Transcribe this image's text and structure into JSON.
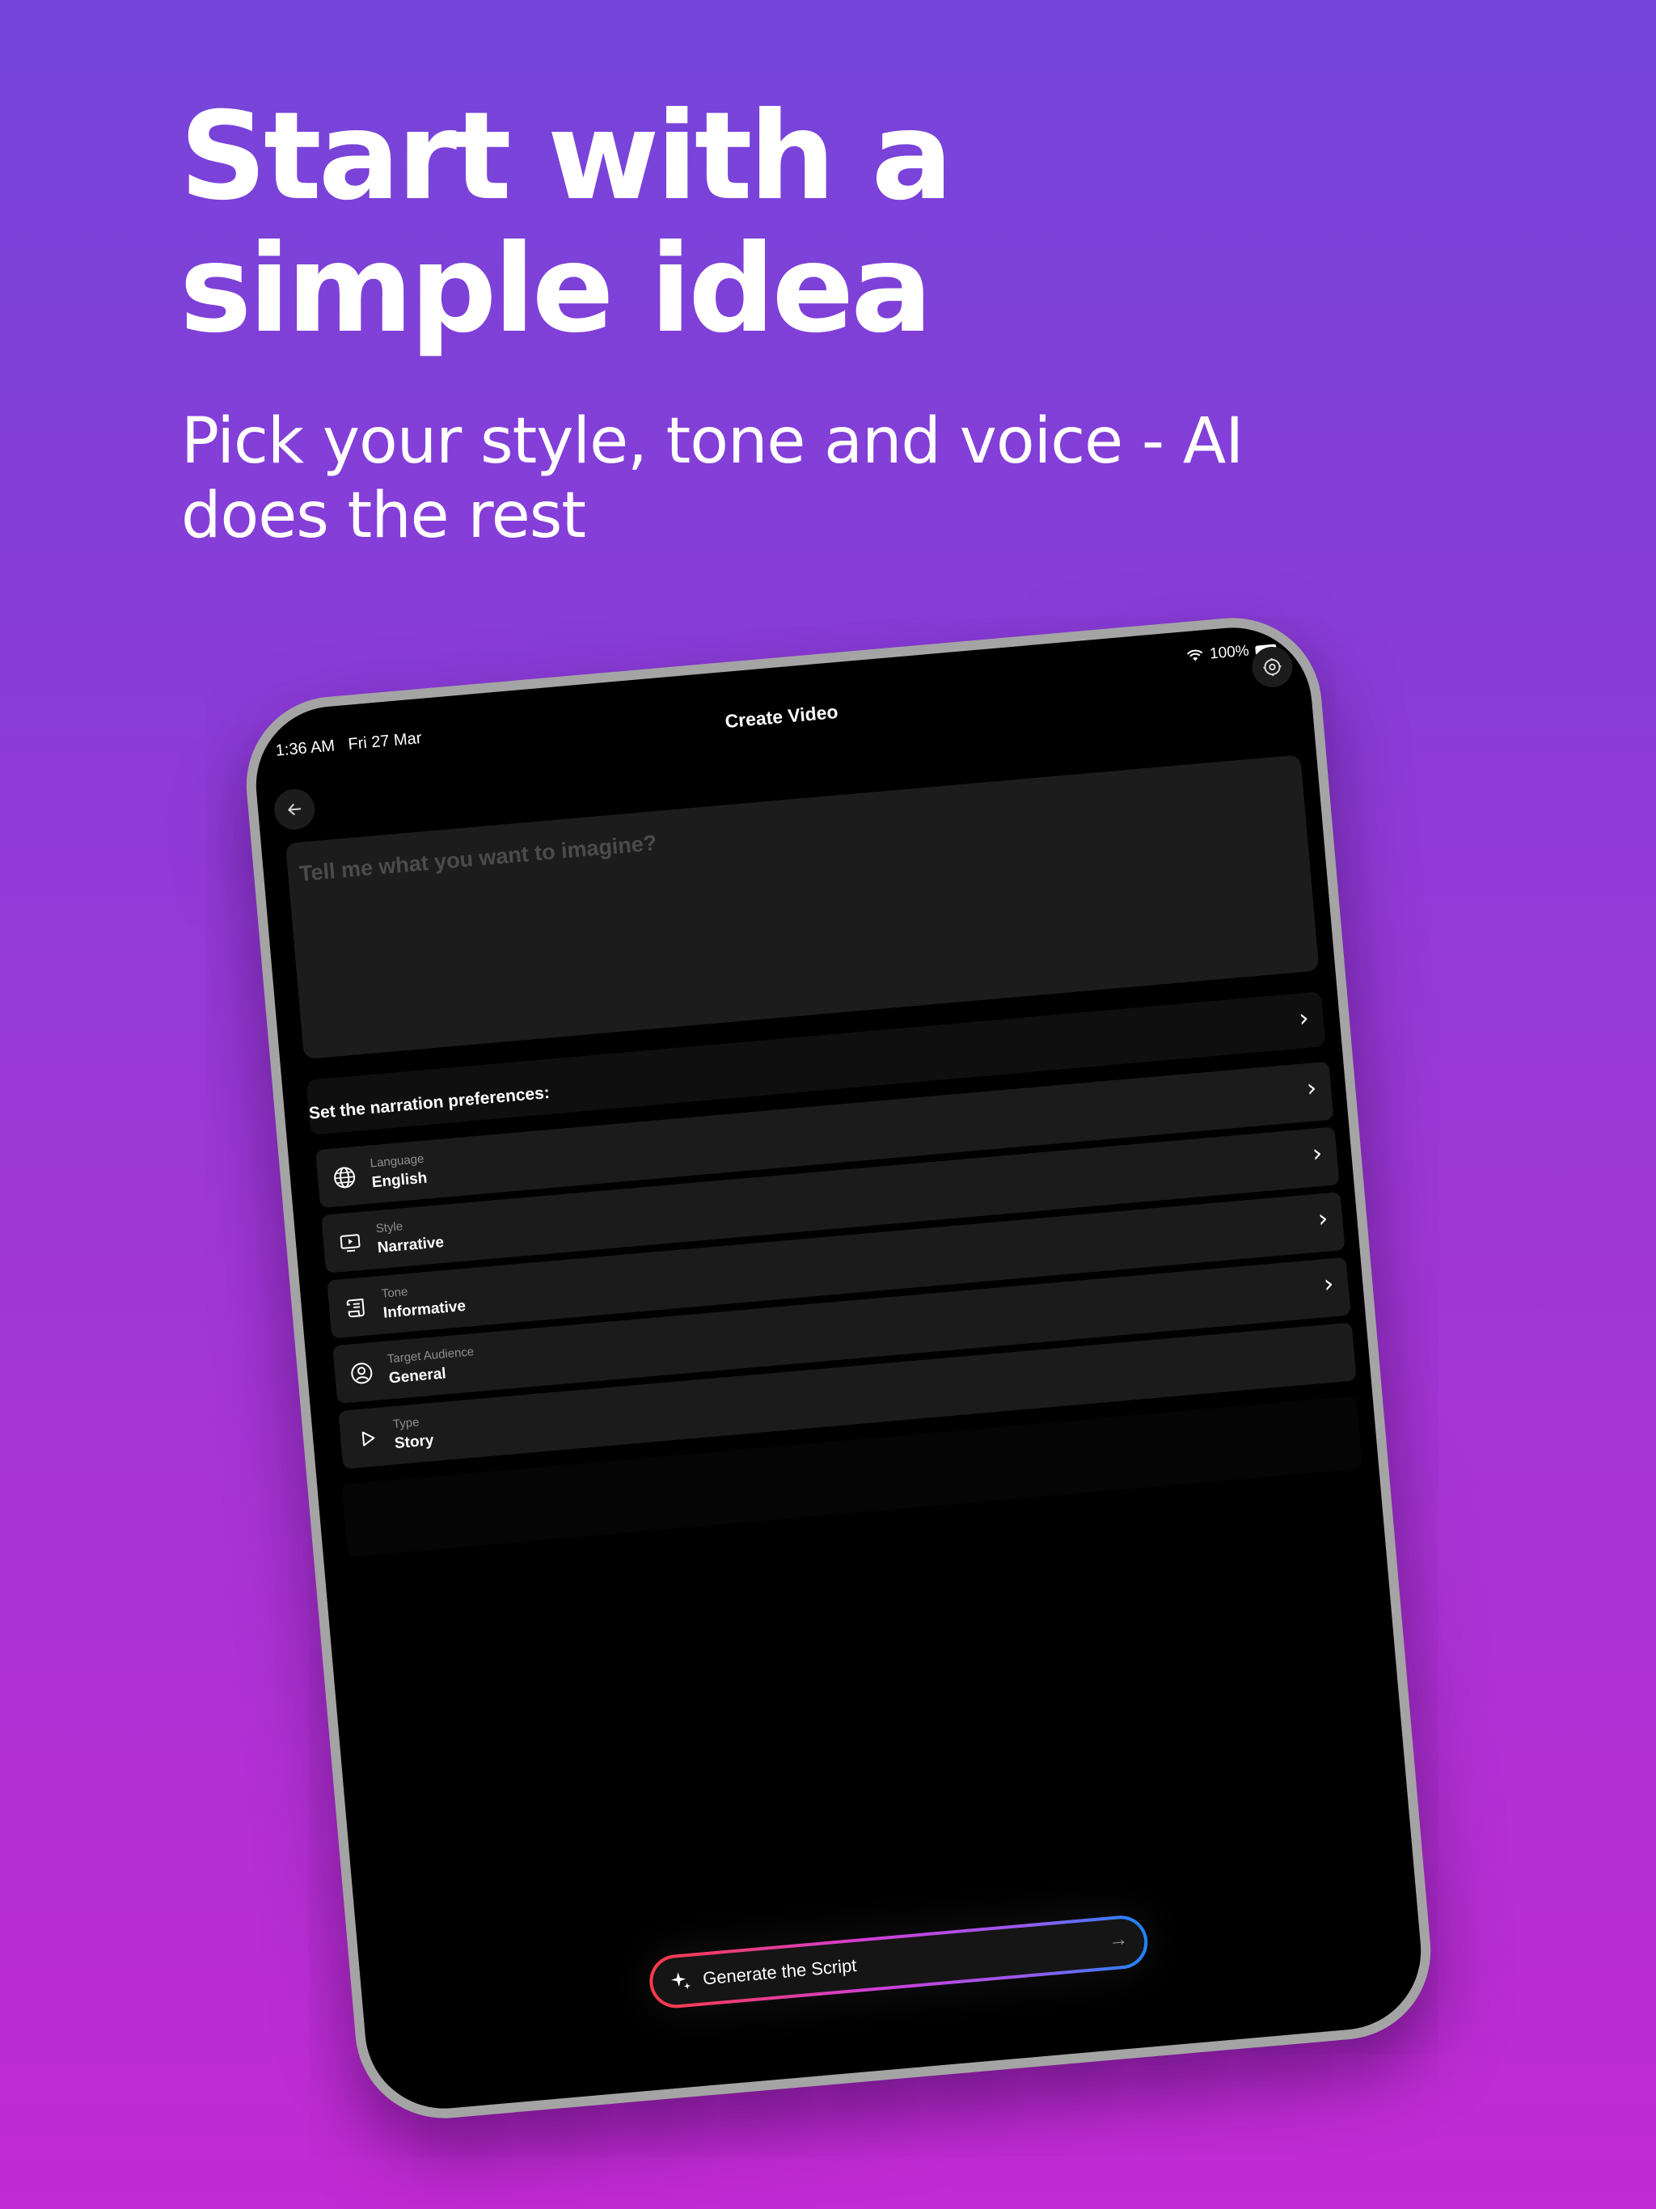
{
  "hero": {
    "title_line1": "Start with a",
    "title_line2": "simple idea",
    "subtitle_line1": "Pick your style, tone and voice - AI",
    "subtitle_line2": "does the rest"
  },
  "status_bar": {
    "time": "1:36 AM",
    "date": "Fri 27 Mar",
    "battery": "100%"
  },
  "nav": {
    "title": "Create Video",
    "back_icon": "arrow-left-icon",
    "settings_icon": "settings-icon"
  },
  "prompt": {
    "placeholder": "Tell me what you want to imagine?"
  },
  "preferences": {
    "heading": "Set the narration preferences:",
    "items": [
      {
        "label": "Language",
        "value": "English",
        "icon": "globe-icon"
      },
      {
        "label": "Style",
        "value": "Narrative",
        "icon": "video-icon"
      },
      {
        "label": "Tone",
        "value": "Informative",
        "icon": "scroll-icon"
      },
      {
        "label": "Target Audience",
        "value": "General",
        "icon": "user-icon"
      },
      {
        "label": "Type",
        "value": "Story",
        "icon": "play-icon"
      }
    ]
  },
  "generate": {
    "label": "Generate the Script"
  },
  "colors": {
    "background_top": "#7545d9",
    "background_bottom": "#c22ad3",
    "gradient_border": [
      "#ff3b45",
      "#d03fd8",
      "#9a5af0",
      "#1f84ff"
    ]
  }
}
